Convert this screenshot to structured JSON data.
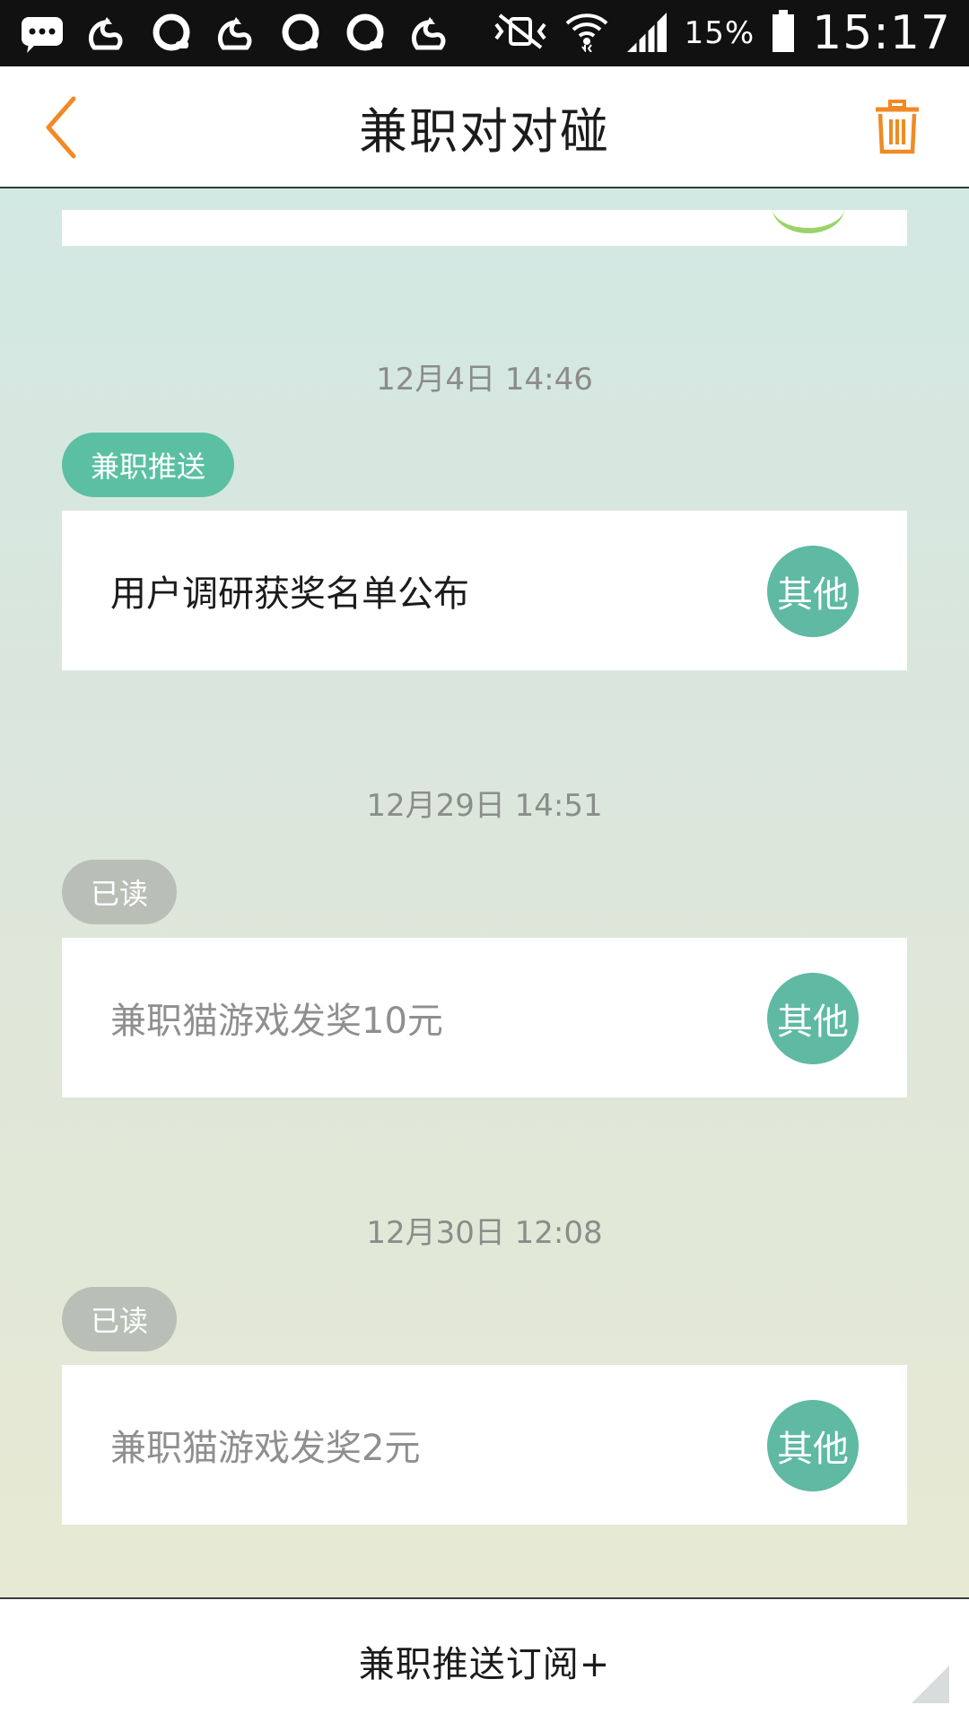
{
  "status_bar": {
    "battery_percent": "15%",
    "time": "15:17",
    "left_icons": [
      "chat-bubble-icon",
      "uc-browser-icon",
      "qq-icon",
      "uc-browser-icon",
      "qq-icon",
      "qq-icon",
      "uc-browser-icon"
    ],
    "right_icons": [
      "vibrate-mute-icon",
      "wifi-icon",
      "signal-icon",
      "battery-icon"
    ]
  },
  "header": {
    "title": "兼职对对碰",
    "back_icon": "chevron-left-icon",
    "delete_icon": "trash-icon"
  },
  "colors": {
    "accent_orange": "#f08a24",
    "tag_new": "#5bc0a2",
    "tag_read": "#b9bfb7",
    "badge": "#5fb9a3"
  },
  "messages": [
    {
      "timestamp": "12月4日 14:46",
      "tag": "兼职推送",
      "title": "用户调研获奖名单公布",
      "category": "其他",
      "read": false
    },
    {
      "timestamp": "12月29日 14:51",
      "tag": "已读",
      "title": "兼职猫游戏发奖10元",
      "category": "其他",
      "read": true
    },
    {
      "timestamp": "12月30日 12:08",
      "tag": "已读",
      "title": "兼职猫游戏发奖2元",
      "category": "其他",
      "read": true
    }
  ],
  "bottom_bar": {
    "subscribe_label": "兼职推送订阅+"
  }
}
